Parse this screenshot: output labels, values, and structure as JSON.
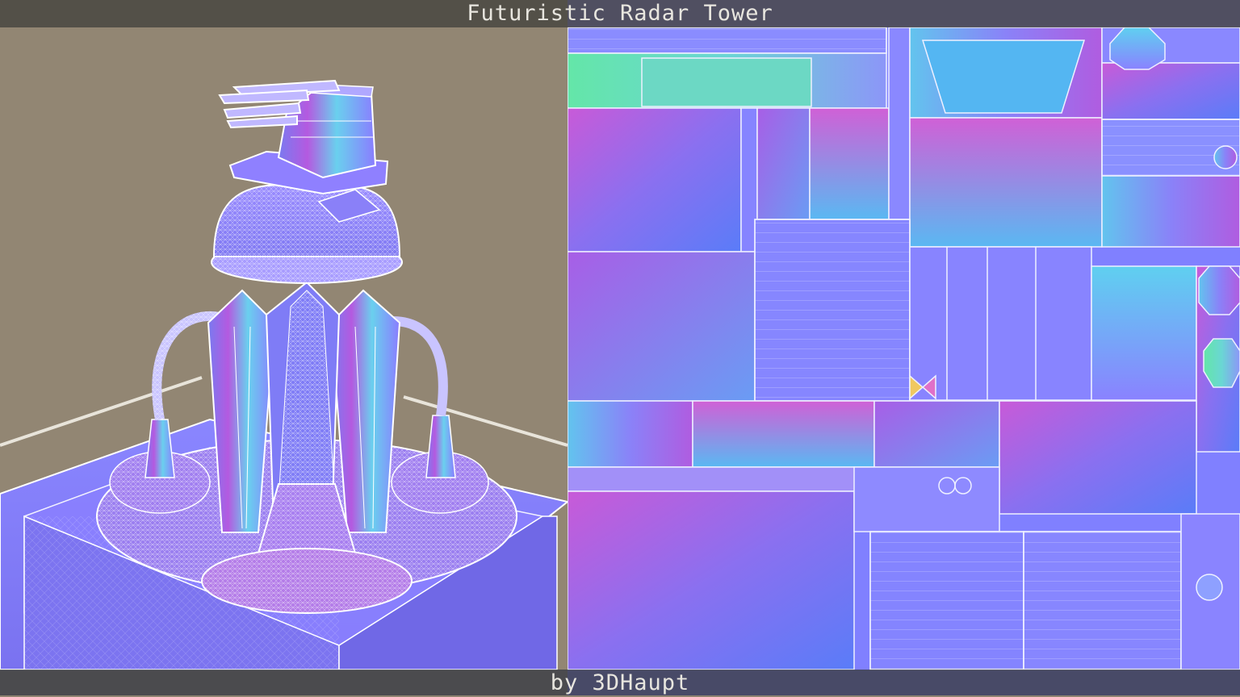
{
  "header": {
    "title": "Futuristic Radar Tower"
  },
  "footer": {
    "credit": "by 3DHaupt"
  },
  "panels": {
    "left": {
      "content": "wireframe-model-viewport"
    },
    "right": {
      "content": "normal-map-texture-atlas"
    }
  },
  "colors": {
    "viewport_bg": "#8e8370",
    "normal_base": "#8080ff",
    "normal_magenta": "#c85ad8",
    "normal_cyan": "#5fd6e6",
    "wire": "#ffffff",
    "bar_bg": "#46443e"
  }
}
